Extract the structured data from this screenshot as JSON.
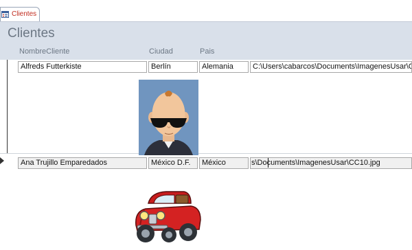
{
  "tab": {
    "label": "Clientes"
  },
  "form": {
    "title": "Clientes",
    "columns": {
      "nombre": "NombreCliente",
      "ciudad": "Ciudad",
      "pais": "Pais"
    }
  },
  "records": [
    {
      "nombre": "Alfreds Futterkiste",
      "ciudad": "Berlín",
      "pais": "Alemania",
      "ruta": "C:\\Users\\cabarcos\\Documents\\ImagenesUsar\\C"
    },
    {
      "nombre": "Ana Trujillo Emparedados",
      "ciudad": "México D.F.",
      "pais": "México",
      "ruta": "s\\Documents\\ImagenesUsar\\CC10.jpg"
    }
  ],
  "colors": {
    "header_band": "#d9e0ea",
    "tab_text": "#c02b1e",
    "caption_text": "#6c7784"
  },
  "icons": {
    "tab": "form-icon",
    "record_pointer": "triangle-right-icon"
  }
}
